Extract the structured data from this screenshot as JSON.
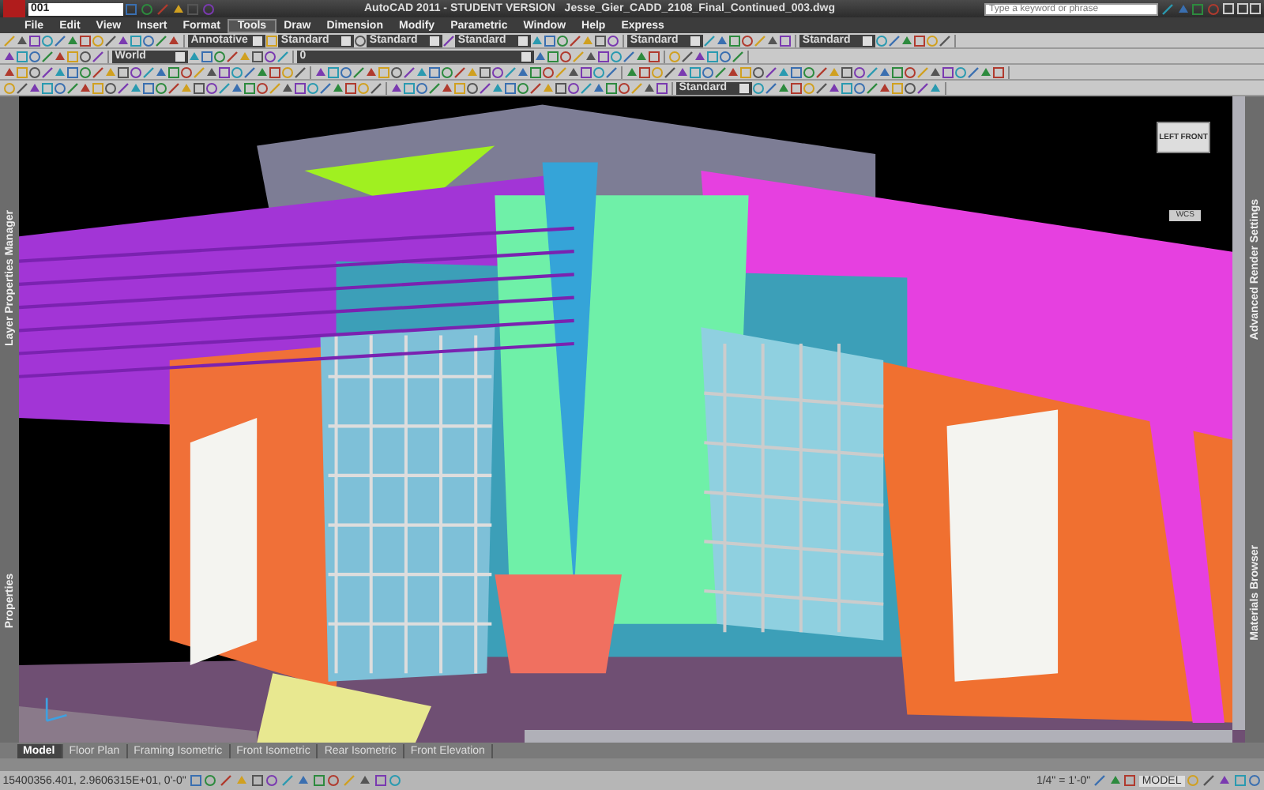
{
  "window": {
    "title": "AutoCAD 2011 - STUDENT VERSION   Jesse_Gier_CADD_2108_Final_Continued_003.dwg"
  },
  "quick_access": {
    "workspace": "001"
  },
  "search": {
    "placeholder": "Type a keyword or phrase"
  },
  "menu": [
    {
      "label": "File",
      "selected": false
    },
    {
      "label": "Edit",
      "selected": false
    },
    {
      "label": "View",
      "selected": false
    },
    {
      "label": "Insert",
      "selected": false
    },
    {
      "label": "Format",
      "selected": false
    },
    {
      "label": "Tools",
      "selected": true
    },
    {
      "label": "Draw",
      "selected": false
    },
    {
      "label": "Dimension",
      "selected": false
    },
    {
      "label": "Modify",
      "selected": false
    },
    {
      "label": "Parametric",
      "selected": false
    },
    {
      "label": "Window",
      "selected": false
    },
    {
      "label": "Help",
      "selected": false
    },
    {
      "label": "Express",
      "selected": false
    }
  ],
  "toolbars": [
    [
      {
        "kind": "tools"
      },
      {
        "kind": "dropdown",
        "value": "Annotative"
      },
      {
        "kind": "dropdown",
        "value": "Standard"
      },
      {
        "kind": "dropdown",
        "value": "Standard"
      },
      {
        "kind": "dropdown",
        "value": "Standard"
      },
      {
        "kind": "tools"
      },
      {
        "kind": "dropdown",
        "value": "Standard"
      },
      {
        "kind": "tools"
      },
      {
        "kind": "dropdown",
        "value": "Standard"
      },
      {
        "kind": "tools"
      }
    ],
    [
      {
        "kind": "tools"
      },
      {
        "kind": "dropdown",
        "value": "World"
      },
      {
        "kind": "tools"
      },
      {
        "kind": "dropdown",
        "value": "0"
      },
      {
        "kind": "tools"
      },
      {
        "kind": "tools"
      }
    ],
    [
      {
        "kind": "tools"
      },
      {
        "kind": "tools"
      },
      {
        "kind": "tools"
      }
    ],
    [
      {
        "kind": "tools"
      },
      {
        "kind": "tools"
      },
      {
        "kind": "dropdown",
        "value": "Standard"
      },
      {
        "kind": "tools"
      }
    ]
  ],
  "viewport": {
    "viewcube": {
      "left": "LEFT",
      "front": "FRONT",
      "ucs": "WCS"
    }
  },
  "side_palettes": {
    "left": [
      "Layer Properties Manager",
      "Properties"
    ],
    "right": [
      "Advanced Render Settings",
      "Materials Browser"
    ]
  },
  "layout_tabs": [
    {
      "label": "Model",
      "selected": true
    },
    {
      "label": "Floor Plan",
      "selected": false
    },
    {
      "label": "Framing Isometric",
      "selected": false
    },
    {
      "label": "Front Isometric",
      "selected": false
    },
    {
      "label": "Rear Isometric",
      "selected": false
    },
    {
      "label": "Front Elevation",
      "selected": false
    }
  ],
  "status_bar": {
    "coordinates": "15400356.401, 2.9606315E+01, 0'-0\"",
    "annotation_scale": "1/4\" = 1'-0\"",
    "space": "MODEL"
  }
}
